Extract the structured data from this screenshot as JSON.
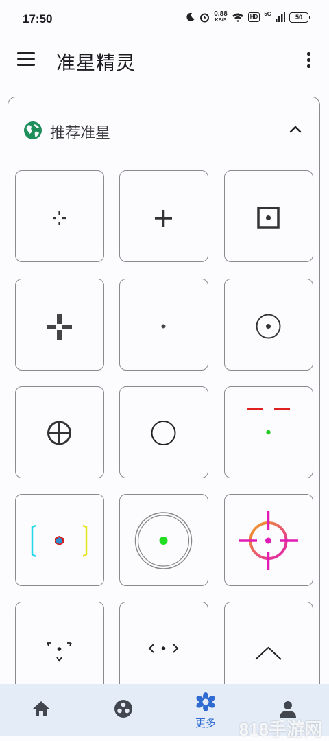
{
  "status_bar": {
    "time": "17:50",
    "net_speed": "0.88",
    "net_unit": "KB/S",
    "hd": "HD",
    "signal": "5G",
    "battery": "50"
  },
  "app_bar": {
    "title": "准星精灵"
  },
  "section": {
    "title": "推荐准星",
    "expanded": true
  },
  "crosshairs": [
    {
      "name": "dotted-cross"
    },
    {
      "name": "plus"
    },
    {
      "name": "square-dot"
    },
    {
      "name": "bold-cross"
    },
    {
      "name": "center-dot"
    },
    {
      "name": "circle-dot"
    },
    {
      "name": "circle-cross"
    },
    {
      "name": "circle"
    },
    {
      "name": "red-dash-green-dot"
    },
    {
      "name": "bracket-hexagon"
    },
    {
      "name": "double-ring-green-dot"
    },
    {
      "name": "gradient-scope"
    },
    {
      "name": "triangle-corners"
    },
    {
      "name": "angle-brackets"
    },
    {
      "name": "caret-up"
    }
  ],
  "bottom_nav": {
    "items": [
      {
        "icon": "home-icon",
        "label": ""
      },
      {
        "icon": "palette-icon",
        "label": ""
      },
      {
        "icon": "flower-icon",
        "label": "更多",
        "active": true
      },
      {
        "icon": "person-icon",
        "label": ""
      }
    ]
  },
  "watermark": "818手游网",
  "colors": {
    "accent": "#2f6bd1",
    "globe": "#1e8e5a",
    "red": "#e0201f",
    "green": "#22cc22",
    "magenta": "#e01cb4"
  }
}
